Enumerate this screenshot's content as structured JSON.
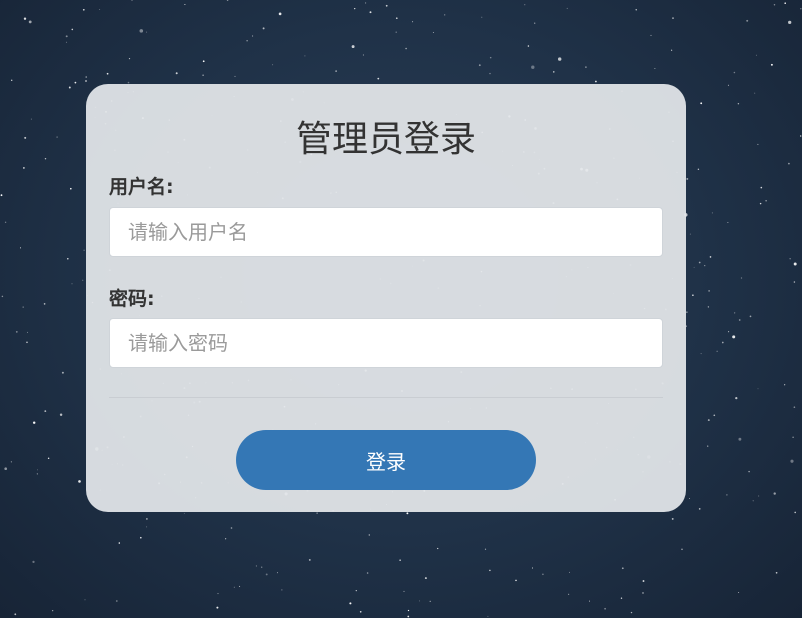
{
  "login": {
    "title": "管理员登录",
    "username_label": "用户名:",
    "username_placeholder": "请输入用户名",
    "username_value": "",
    "password_label": "密码:",
    "password_placeholder": "请输入密码",
    "password_value": "",
    "submit_label": "登录"
  },
  "colors": {
    "background": "#1f3147",
    "card": "#e2e5e9",
    "button": "#3477b5",
    "text": "#333333"
  }
}
